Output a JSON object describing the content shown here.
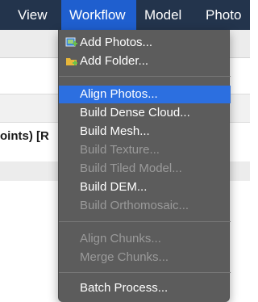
{
  "menubar": {
    "items": [
      {
        "label": "View"
      },
      {
        "label": "Workflow"
      },
      {
        "label": "Model"
      },
      {
        "label": "Photo"
      }
    ]
  },
  "background": {
    "partial_text": "oints) [R"
  },
  "workflow_menu": {
    "items": [
      {
        "label": "Add Photos...",
        "enabled": true,
        "icon": "add-photos-icon"
      },
      {
        "label": "Add Folder...",
        "enabled": true,
        "icon": "add-folder-icon"
      },
      {
        "label": "Align Photos...",
        "enabled": true,
        "highlighted": true
      },
      {
        "label": "Build Dense Cloud...",
        "enabled": true
      },
      {
        "label": "Build Mesh...",
        "enabled": true
      },
      {
        "label": "Build Texture...",
        "enabled": false
      },
      {
        "label": "Build Tiled Model...",
        "enabled": false
      },
      {
        "label": "Build DEM...",
        "enabled": true
      },
      {
        "label": "Build Orthomosaic...",
        "enabled": false
      },
      {
        "label": "Align Chunks...",
        "enabled": false
      },
      {
        "label": "Merge Chunks...",
        "enabled": false
      },
      {
        "label": "Batch Process...",
        "enabled": true
      }
    ]
  },
  "colors": {
    "menubar_bg": "#23344c",
    "active_menu_bg": "#1f5fcf",
    "dropdown_bg": "#5c5c5c",
    "highlight": "#2c6fe0",
    "disabled_text": "#9a9a9a"
  }
}
